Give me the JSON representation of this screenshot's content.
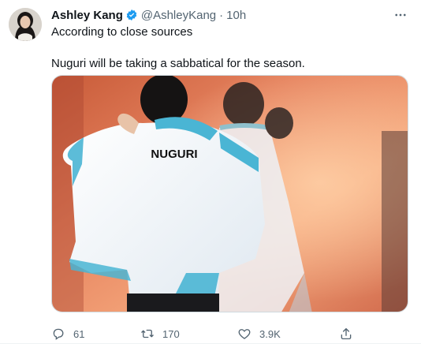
{
  "tweet": {
    "author_name": "Ashley Kang",
    "author_handle": "@AshleyKang",
    "separator": "·",
    "time": "10h",
    "lines": [
      "According to close sources",
      "Nuguri will be taking a sabbatical for the season."
    ],
    "jersey_text": "NUGURI",
    "stats": {
      "replies": "61",
      "retweets": "170",
      "likes": "3.9K"
    }
  },
  "colors": {
    "verified": "#1d9bf0",
    "secondary_text": "#536471",
    "jacket_accent": "#48b7d3"
  },
  "icons": {
    "verified": "verified-badge-icon",
    "more": "more-options-icon",
    "reply": "reply-icon",
    "retweet": "retweet-icon",
    "like": "heart-icon",
    "share": "share-icon"
  }
}
